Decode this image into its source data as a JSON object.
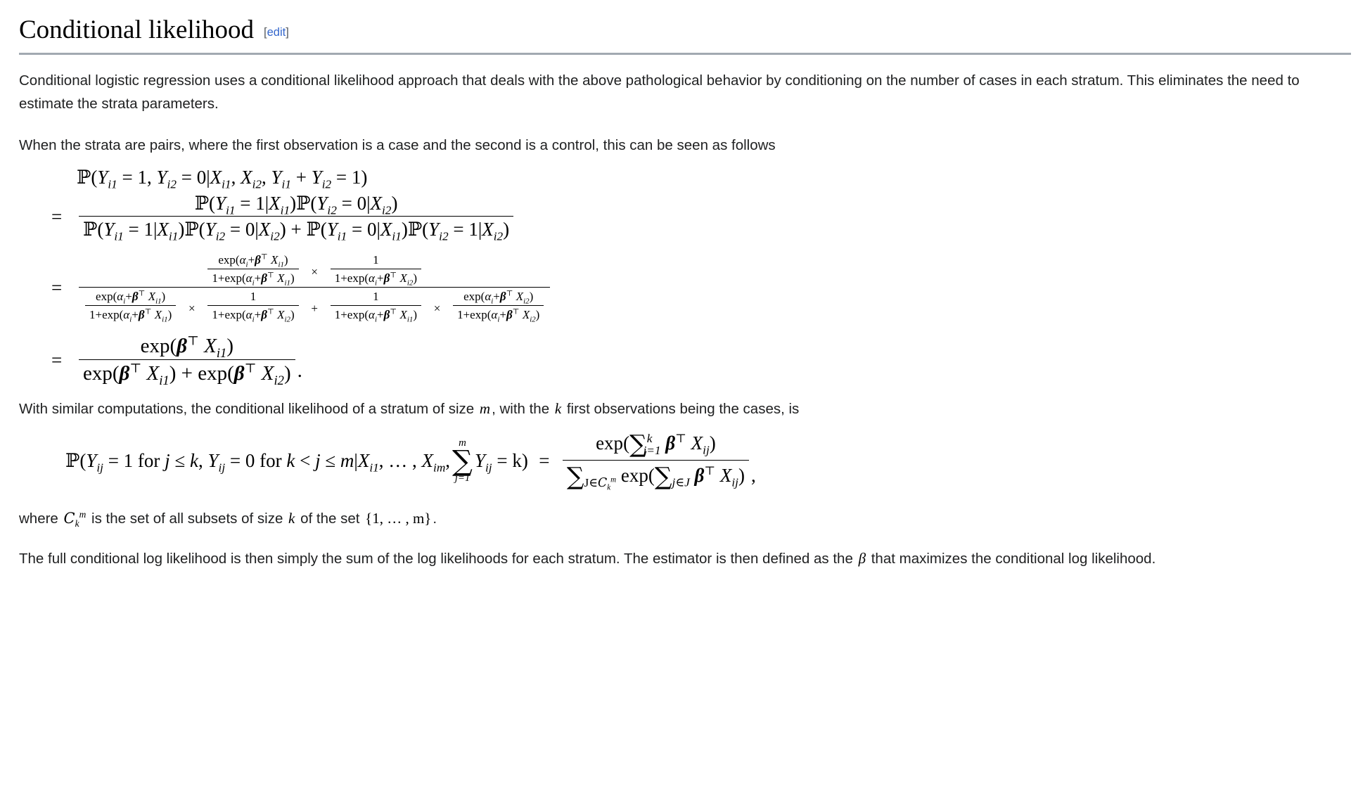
{
  "heading": {
    "title": "Conditional likelihood",
    "edit_open_bracket": "[",
    "edit_label": "edit",
    "edit_close_bracket": "]",
    "link_color": "#3366cc",
    "rule_color": "#a2a9b1"
  },
  "paragraphs": {
    "intro": "Conditional logistic regression uses a conditional likelihood approach that deals with the above pathological behavior by conditioning on the number of cases in each stratum. This eliminates the need to estimate the strata parameters.",
    "pairs_lead": "When the strata are pairs, where the first observation is a case and the second is a control, this can be seen as follows",
    "similar_a": "With similar computations, the conditional likelihood of a stratum of size",
    "similar_m": "m",
    "similar_b": ", with the",
    "similar_k": "k",
    "similar_c": "first observations being the cases, is",
    "where_a": "where",
    "where_C": "C",
    "where_C_sub": "k",
    "where_C_sup": "m",
    "where_b": "is the set of all subsets of size",
    "where_k": "k",
    "where_c": "of the set",
    "where_set": "{1, … , m}",
    "where_period": ".",
    "final_a": "The full conditional log likelihood is then simply the sum of the log likelihoods for each stratum. The estimator is then defined as the",
    "final_beta": "β",
    "final_b": "that maximizes the conditional log likelihood."
  },
  "equation1": {
    "line1": {
      "P": "ℙ",
      "open": "(",
      "Y1": "Y",
      "Y1_sub": "i1",
      "eq1": "= 1,",
      "Y2": "Y",
      "Y2_sub": "i2",
      "eq2": "= 0",
      "bar": "|",
      "X1": "X",
      "X1_sub": "i1",
      "comma1": ",",
      "X2": "X",
      "X2_sub": "i2",
      "comma2": ",",
      "Y3": "Y",
      "Y3_sub": "i1",
      "plus": "+",
      "Y4": "Y",
      "Y4_sub": "i2",
      "eq3": "= 1",
      "close": ")"
    },
    "line2": {
      "eqsign": "=",
      "numerator": "ℙ(Y_i1 = 1|X_i1)ℙ(Y_i2 = 0|X_i2)",
      "denominator": "ℙ(Y_i1 = 1|X_i1)ℙ(Y_i2 = 0|X_i2) + ℙ(Y_i1 = 0|X_i1)ℙ(Y_i2 = 1|X_i2)"
    },
    "line3": {
      "eqsign": "=",
      "times": "×",
      "plus": "+",
      "exp": "exp",
      "alpha": "α",
      "beta": "β",
      "transpose": "⊤",
      "one": "1",
      "one_plus": "1+"
    },
    "line4": {
      "eqsign": "=",
      "exp": "exp",
      "beta": "β",
      "transpose": "⊤",
      "plus": "+",
      "X": "X",
      "sub1": "i1",
      "sub2": "i2",
      "period": "."
    }
  },
  "equation2": {
    "P": "ℙ",
    "open": "(",
    "Y": "Y",
    "Y_sub": "ij",
    "eq_one": "= 1 for",
    "j": "j",
    "leq": "≤",
    "k": "k",
    "comma": ",",
    "eq_zero": "= 0 for",
    "k2": "k",
    "lt": "<",
    "j2": "j",
    "leq2": "≤",
    "m": "m",
    "bar": "|",
    "X1": "X",
    "X1_sub": "i1",
    "dots": ", … ,",
    "Xm": "X",
    "Xm_sub": "im",
    "comma2": ",",
    "sum_top": "m",
    "sum_sym": "∑",
    "sum_bot": "j=1",
    "Y2": "Y",
    "Y2_sub": "ij",
    "eq_k": "= k",
    "close": ")",
    "equals": "=",
    "num_exp": "exp",
    "num_sum": "∑",
    "num_sum_sup": "k",
    "num_sum_sub": "j=1",
    "num_beta": "β",
    "num_transpose": "⊤",
    "num_X": "X",
    "num_X_sub": "ij",
    "den_sum": "∑",
    "den_sum_sub": "J∈",
    "den_C": "C",
    "den_C_sub": "k",
    "den_C_sup": "m",
    "den_exp": "exp",
    "den_inner_sum": "∑",
    "den_inner_sub": "j∈J",
    "den_beta": "β",
    "den_transpose": "⊤",
    "den_X": "X",
    "den_X_sub": "ij",
    "trailing_comma": ","
  }
}
